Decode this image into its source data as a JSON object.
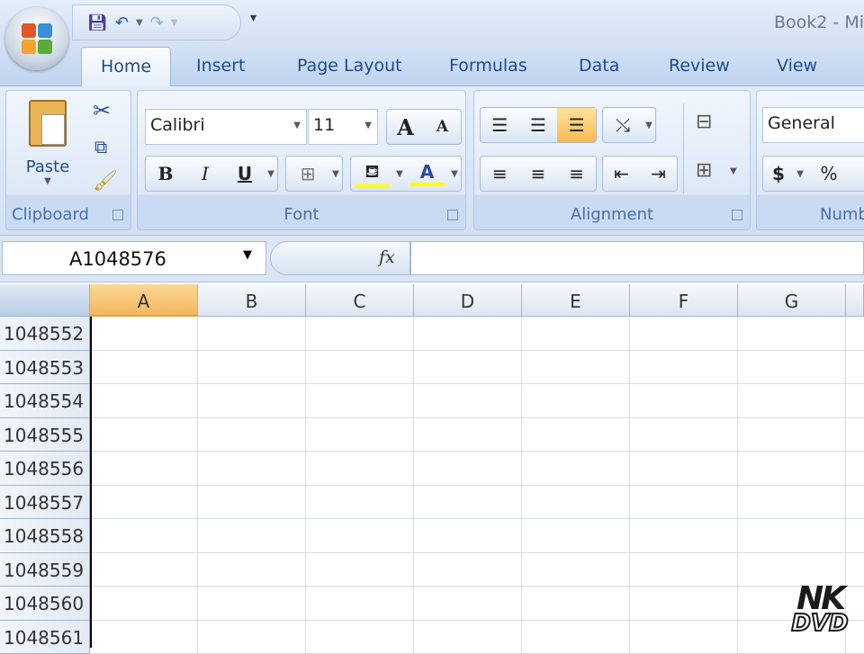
{
  "window": {
    "title": "Book2 - Mi"
  },
  "qat": {
    "save_icon": "save-icon",
    "undo_icon": "undo-icon",
    "redo_icon": "redo-icon",
    "customize": "▾"
  },
  "tabs": [
    "Home",
    "Insert",
    "Page Layout",
    "Formulas",
    "Data",
    "Review",
    "View"
  ],
  "ribbon": {
    "clipboard": {
      "label": "Clipboard",
      "paste": "Paste"
    },
    "font": {
      "label": "Font",
      "name": "Calibri",
      "size": "11",
      "bold": "B",
      "italic": "I",
      "underline": "U",
      "grow": "A",
      "shrink": "A",
      "font_color": "A"
    },
    "alignment": {
      "label": "Alignment"
    },
    "number": {
      "label": "Numb",
      "format": "General",
      "currency": "$",
      "percent": "%"
    }
  },
  "formula_bar": {
    "name_box": "A1048576",
    "fx": "fx",
    "value": ""
  },
  "grid": {
    "columns": [
      "A",
      "B",
      "C",
      "D",
      "E",
      "F",
      "G"
    ],
    "selected_column": "A",
    "rows": [
      "1048552",
      "1048553",
      "1048554",
      "1048555",
      "1048556",
      "1048557",
      "1048558",
      "1048559",
      "1048560",
      "1048561"
    ]
  },
  "watermark": {
    "line1": "NK",
    "line2": "DVD"
  },
  "colors": {
    "accent": "#1f4a8a",
    "selection": "#f4b75c",
    "highlight": "#ffff00"
  }
}
